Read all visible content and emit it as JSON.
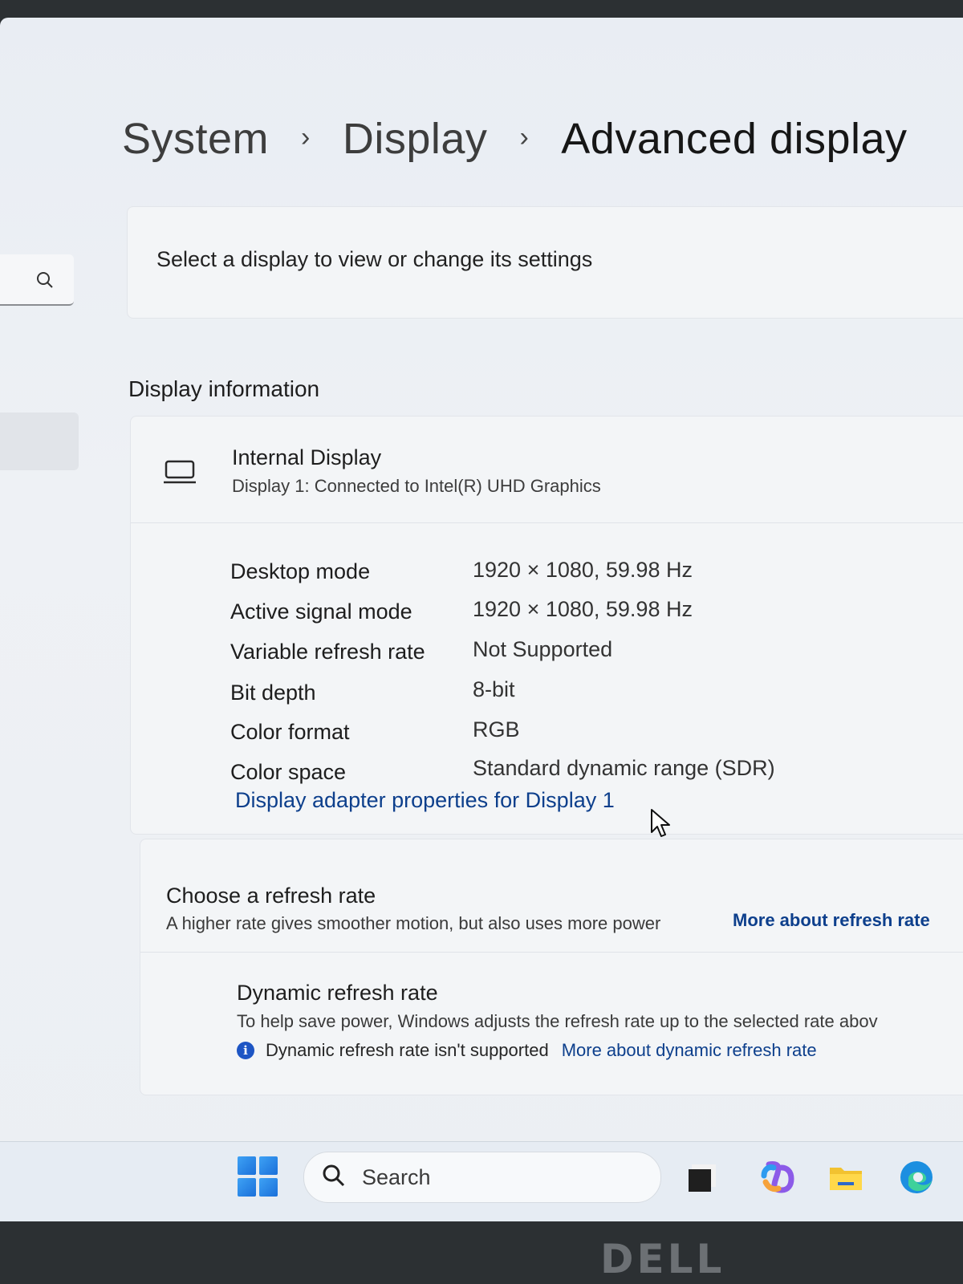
{
  "breadcrumb": {
    "items": [
      "System",
      "Display",
      "Advanced display"
    ],
    "separator": "›"
  },
  "select_display": {
    "text": "Select a display to view or change its settings"
  },
  "display_info": {
    "section_title": "Display information",
    "display_name": "Internal Display",
    "display_subtitle": "Display 1: Connected to Intel(R) UHD Graphics",
    "properties": [
      {
        "label": "Desktop mode",
        "value": "1920 × 1080, 59.98 Hz"
      },
      {
        "label": "Active signal mode",
        "value": "1920 × 1080, 59.98 Hz"
      },
      {
        "label": "Variable refresh rate",
        "value": "Not Supported"
      },
      {
        "label": "Bit depth",
        "value": "8-bit"
      },
      {
        "label": "Color format",
        "value": "RGB"
      },
      {
        "label": "Color space",
        "value": "Standard dynamic range (SDR)"
      }
    ],
    "adapter_link": "Display adapter properties for Display 1"
  },
  "refresh": {
    "title": "Choose a refresh rate",
    "description": "A higher rate gives smoother motion, but also uses more power",
    "more_link": "More about refresh rate",
    "dynamic_title": "Dynamic refresh rate",
    "dynamic_desc": "To help save power, Windows adjusts the refresh rate up to the selected rate abov",
    "dynamic_note": "Dynamic refresh rate isn't supported",
    "dynamic_link": "More about dynamic refresh rate"
  },
  "taskbar": {
    "search_label": "Search",
    "apps": [
      "start-icon",
      "task-view-icon",
      "copilot-icon",
      "file-explorer-icon",
      "edge-icon"
    ]
  },
  "bezel": {
    "brand": "DELL"
  },
  "colors": {
    "link": "#0d3f8c",
    "info_accent": "#1d55c4",
    "background": "#eceff3"
  }
}
